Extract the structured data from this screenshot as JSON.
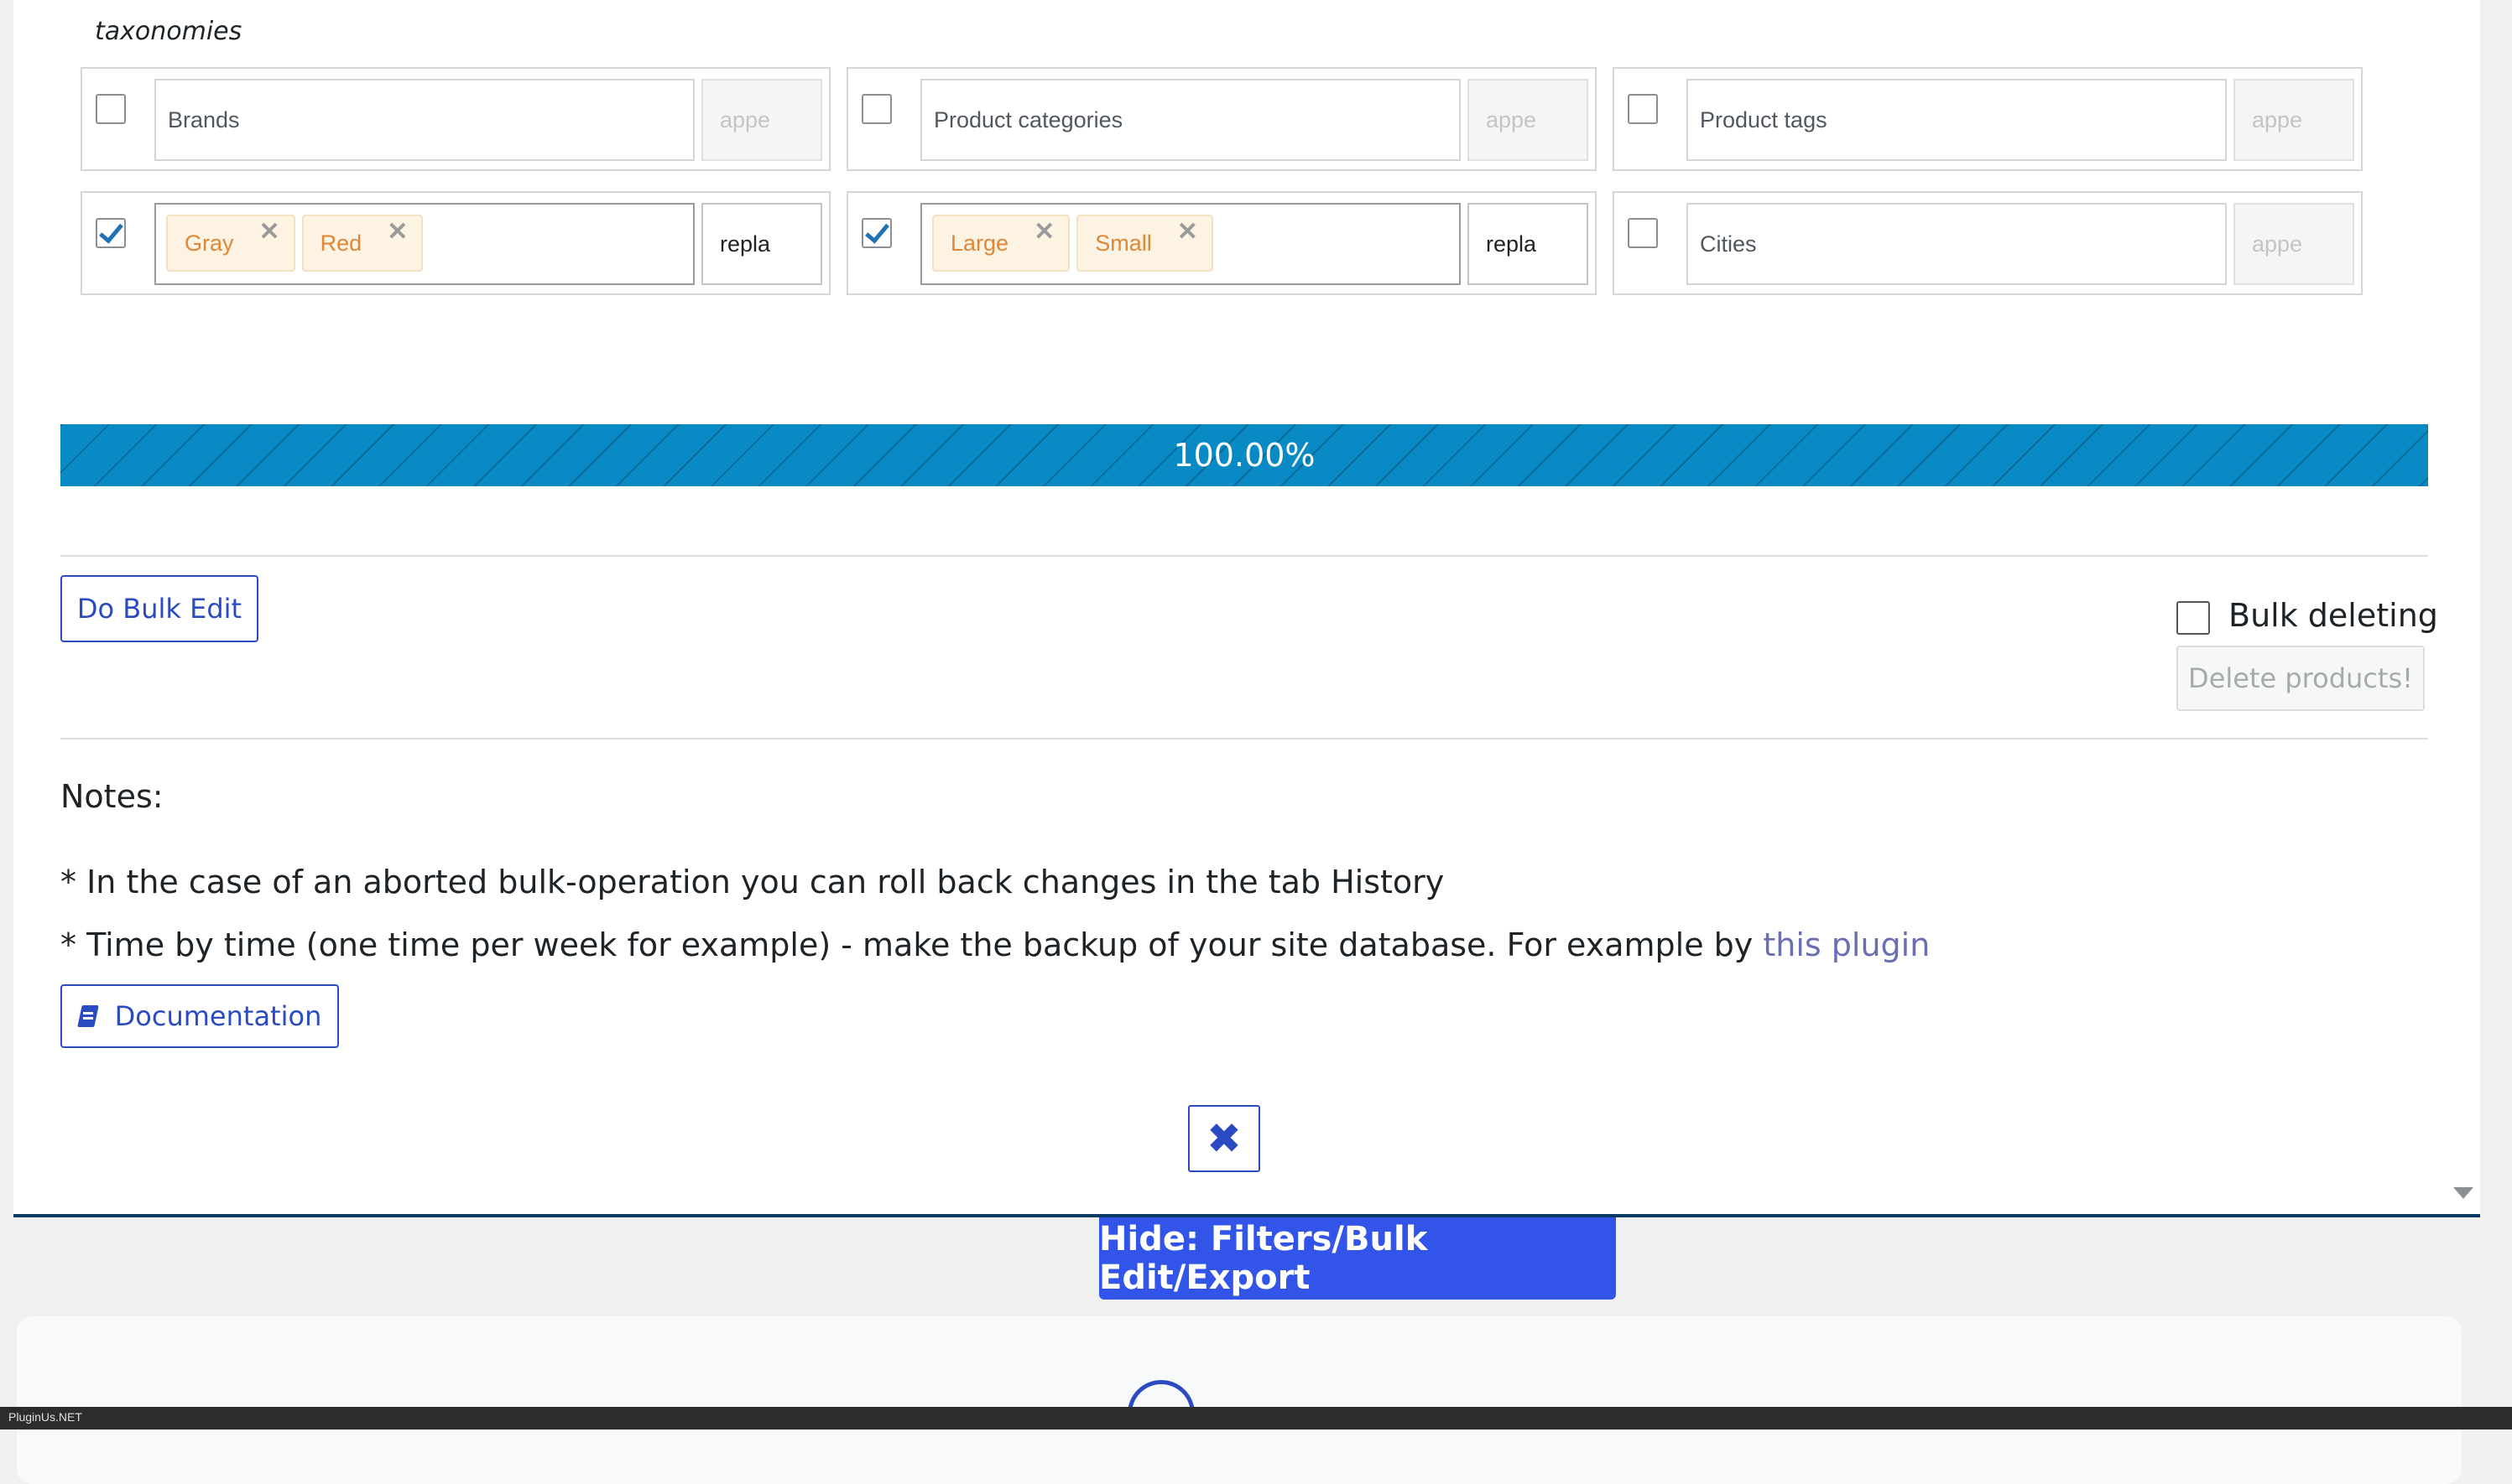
{
  "taxonomies": {
    "title": "taxonomies",
    "rows": [
      [
        {
          "checked": false,
          "placeholder": "Brands",
          "tags": [],
          "mode": "appe"
        },
        {
          "checked": false,
          "placeholder": "Product categories",
          "tags": [],
          "mode": "appe"
        },
        {
          "checked": false,
          "placeholder": "Product tags",
          "tags": [],
          "mode": "appe"
        }
      ],
      [
        {
          "checked": true,
          "tags": [
            "Gray",
            "Red"
          ],
          "mode": "repla"
        },
        {
          "checked": true,
          "tags": [
            "Large",
            "Small"
          ],
          "mode": "repla"
        },
        {
          "checked": false,
          "placeholder": "Cities",
          "tags": [],
          "mode": "appe"
        }
      ]
    ]
  },
  "progress": {
    "label": "100.00%",
    "percent": 100
  },
  "actions": {
    "bulk_edit_label": "Do Bulk Edit",
    "bulk_deleting_label": "Bulk deleting",
    "delete_products_label": "Delete products!"
  },
  "notes": {
    "title": "Notes:",
    "line1": "* In the case of an aborted bulk-operation you can roll back changes in the tab History",
    "line2_prefix": "* Time by time (one time per week for example) - make the backup of your site database. For example by ",
    "line2_link": "this plugin",
    "documentation_label": "Documentation"
  },
  "close_symbol": "✖",
  "hide_button_label": "Hide: Filters/Bulk Edit/Export",
  "footer_text": "PluginUs.NET",
  "icons": {
    "documentation": "book-icon",
    "close": "close-icon",
    "logo": "pluginus-logo-icon",
    "scroll": "scroll-down-arrow-icon"
  },
  "colors": {
    "accent": "#2a4bc2",
    "progress": "#0a8ac4",
    "hide_button": "#3354e8",
    "tag_text": "#e08637",
    "link": "#6a6fb3"
  }
}
